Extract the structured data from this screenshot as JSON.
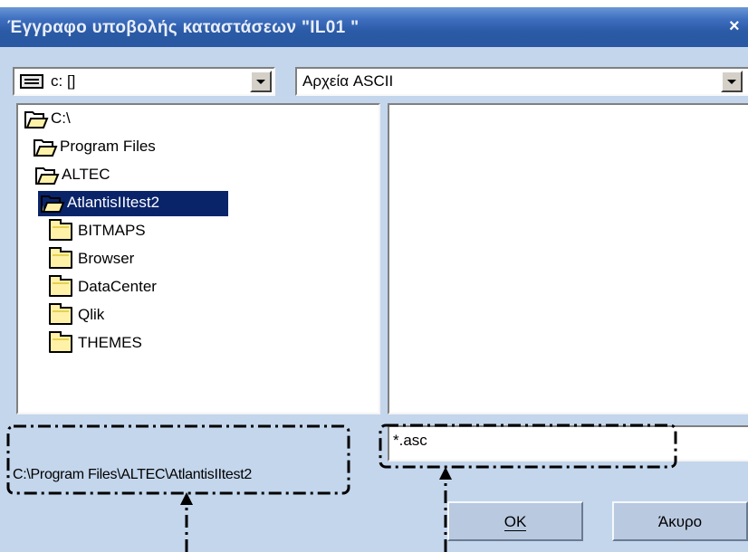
{
  "window": {
    "title": "Έγγραφο υποβολής καταστάσεων \"IL01     \"",
    "close_glyph": "×"
  },
  "drive_combo": {
    "value": "c: []"
  },
  "filetype_combo": {
    "value": "Αρχεία ASCII"
  },
  "folders": [
    {
      "label": "C:\\",
      "state": "open",
      "selected": false
    },
    {
      "label": "Program Files",
      "state": "open",
      "selected": false
    },
    {
      "label": "ALTEC",
      "state": "open",
      "selected": false
    },
    {
      "label": "AtlantisIItest2",
      "state": "open",
      "selected": true
    },
    {
      "label": "BITMAPS",
      "state": "closed",
      "selected": false
    },
    {
      "label": "Browser",
      "state": "closed",
      "selected": false
    },
    {
      "label": "DataCenter",
      "state": "closed",
      "selected": false
    },
    {
      "label": "Qlik",
      "state": "closed",
      "selected": false
    },
    {
      "label": "THEMES",
      "state": "closed",
      "selected": false
    }
  ],
  "pattern_input": {
    "value": "*.asc"
  },
  "current_path": "C:\\Program Files\\ALTEC\\AtlantisIItest2",
  "buttons": {
    "ok_label": "OK",
    "cancel_label": "Άκυρο"
  },
  "colors": {
    "titlebar": "#2b5aa6",
    "client_bg": "#c4d6ec",
    "selection": "#0a246a",
    "folder_fill": "#fff2a8"
  },
  "icons": {
    "drive": "hard-drive-icon",
    "open_folder": "folder-open-icon",
    "closed_folder": "folder-icon",
    "dropdown": "chevron-down-icon"
  }
}
